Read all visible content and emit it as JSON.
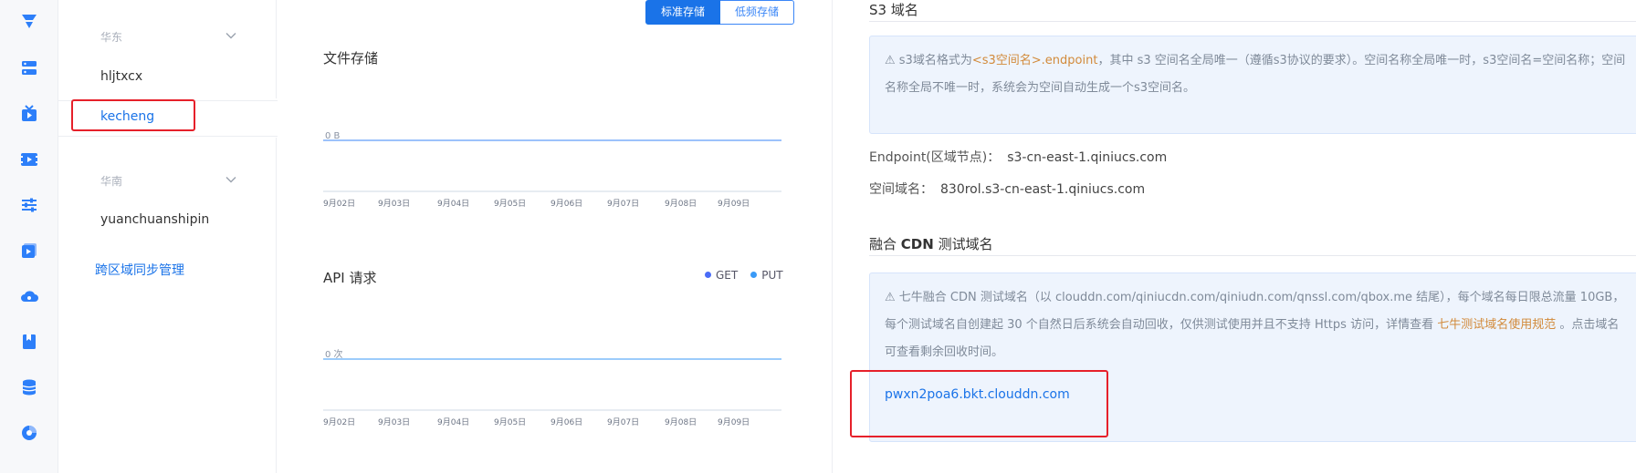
{
  "rail": {
    "icons": [
      "logo-icon",
      "storage-icon",
      "live-icon",
      "video-icon",
      "settings-sliders-icon",
      "media-icon",
      "cloud-icon",
      "book-icon",
      "database-icon",
      "chart-icon"
    ]
  },
  "buckets": {
    "regions": [
      {
        "name": "华东",
        "items": [
          "hljtxcx",
          "kecheng"
        ]
      },
      {
        "name": "华南",
        "items": [
          "yuanchuanshipin"
        ]
      }
    ],
    "selected": "kecheng",
    "cross_region_link": "跨区域同步管理"
  },
  "charts": {
    "segment": {
      "active": "标准存储",
      "inactive": "低频存储"
    },
    "accent": "#3a86f7"
  },
  "chart_data": [
    {
      "type": "line",
      "title": "文件存储",
      "categories": [
        "9月02日",
        "9月03日",
        "9月04日",
        "9月05日",
        "9月06日",
        "9月07日",
        "9月08日",
        "9月09日"
      ],
      "series": [
        {
          "values": [
            0,
            0,
            0,
            0,
            0,
            0,
            0,
            0
          ]
        }
      ],
      "y_tick_labels": [
        "0 B"
      ],
      "grid": true
    },
    {
      "type": "line",
      "title": "API 请求",
      "categories": [
        "9月02日",
        "9月03日",
        "9月04日",
        "9月05日",
        "9月06日",
        "9月07日",
        "9月08日",
        "9月09日"
      ],
      "series": [
        {
          "name": "GET",
          "values": [
            0,
            0,
            0,
            0,
            0,
            0,
            0,
            0
          ],
          "color": "#4a6cf7"
        },
        {
          "name": "PUT",
          "values": [
            0,
            0,
            0,
            0,
            0,
            0,
            0,
            0
          ],
          "color": "#3a9af7"
        }
      ],
      "y_tick_labels": [
        "0 次"
      ],
      "legend": "top-right",
      "grid": true
    }
  ],
  "right": {
    "s3_title": "S3 域名",
    "s3_notice_prefix": "⚠ s3域名格式为",
    "s3_notice_code": "<s3空间名>.endpoint",
    "s3_notice_rest": "，其中 s3 空间名全局唯一（遵循s3协议的要求）。空间名称全局唯一时，s3空间名=空间名称；空间名称全局不唯一时，系统会为空间自动生成一个s3空间名。",
    "endpoint_label": "Endpoint(区域节点)：",
    "endpoint_value": "s3-cn-east-1.qiniucs.com",
    "space_domain_label": "空间域名：",
    "space_domain_value": "830rol.s3-cn-east-1.qiniucs.com",
    "cdn_title_prefix": "融合 ",
    "cdn_title_bold": "CDN",
    "cdn_title_suffix": " 测试域名",
    "cdn_notice_part1": "⚠ 七牛融合 CDN 测试域名（以 clouddn.com/qiniucdn.com/qiniudn.com/qnssl.com/qbox.me 结尾），每个域名每日限总流量 10GB，每个测试域名自创建起 30 个自然日后系统会自动回收，仅供测试使用并且不支持 Https 访问，详情查看 ",
    "cdn_notice_link": "七牛测试域名使用规范",
    "cdn_notice_part2": " 。点击域名可查看剩余回收时间。",
    "cdn_domain": "pwxn2poa6.bkt.clouddn.com",
    "warn_color": "#d28a3a"
  }
}
